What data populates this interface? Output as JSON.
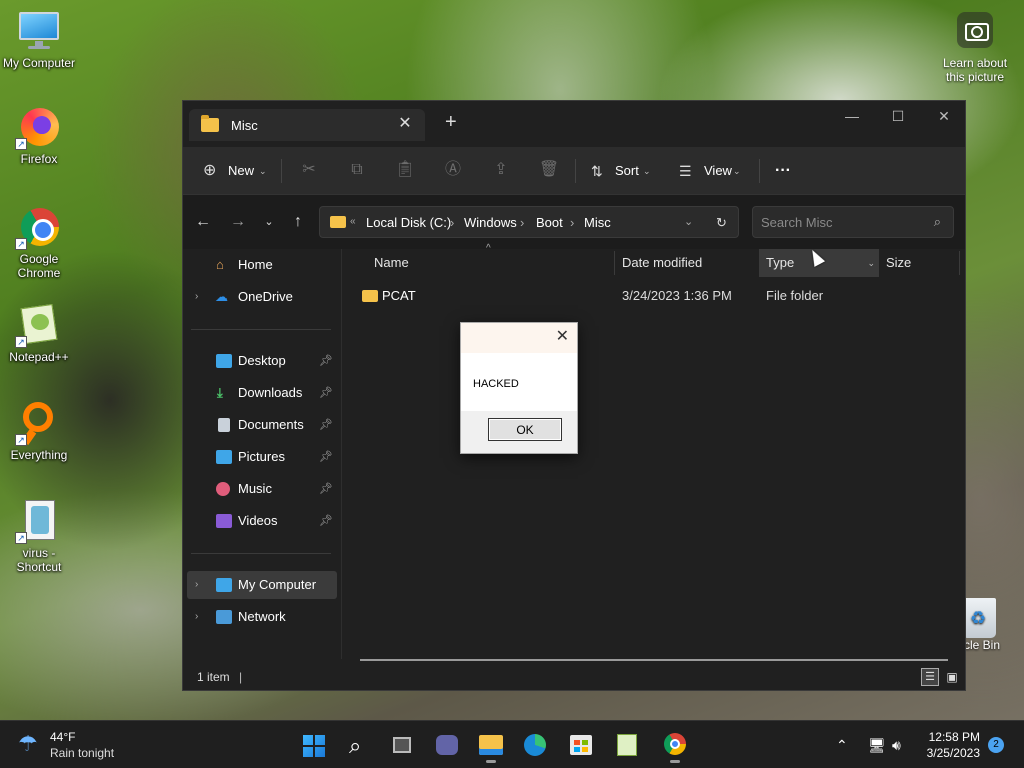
{
  "desktop": {
    "icons": [
      {
        "label": "My Computer"
      },
      {
        "label": "Firefox"
      },
      {
        "label": "Google Chrome"
      },
      {
        "label": "Notepad++"
      },
      {
        "label": "Everything"
      },
      {
        "label": "virus - Shortcut"
      }
    ],
    "camera_label": "Learn about this picture",
    "recycle_label": "ycle Bin"
  },
  "explorer": {
    "tab_title": "Misc",
    "toolbar": {
      "new_label": "New",
      "sort_label": "Sort",
      "view_label": "View",
      "more_label": "···"
    },
    "breadcrumbs": [
      "Local Disk (C:)",
      "Windows",
      "Boot",
      "Misc"
    ],
    "search_placeholder": "Search Misc",
    "sidebar": {
      "home": "Home",
      "onedrive": "OneDrive",
      "desktop": "Desktop",
      "downloads": "Downloads",
      "documents": "Documents",
      "pictures": "Pictures",
      "music": "Music",
      "videos": "Videos",
      "mycomputer": "My Computer",
      "network": "Network"
    },
    "columns": {
      "name": "Name",
      "date": "Date modified",
      "type": "Type",
      "size": "Size"
    },
    "files": [
      {
        "name": "PCAT",
        "date": "3/24/2023 1:36 PM",
        "type": "File folder",
        "size": ""
      }
    ],
    "status": "1 item"
  },
  "dialog": {
    "message": "HACKED",
    "ok_label": "OK"
  },
  "taskbar": {
    "weather_temp": "44°F",
    "weather_desc": "Rain tonight",
    "time": "12:58 PM",
    "date": "3/25/2023",
    "notification_count": "2"
  },
  "colors": {
    "accent": "#4ba3f1",
    "folder": "#f5c24a",
    "window_bg": "#202020"
  }
}
